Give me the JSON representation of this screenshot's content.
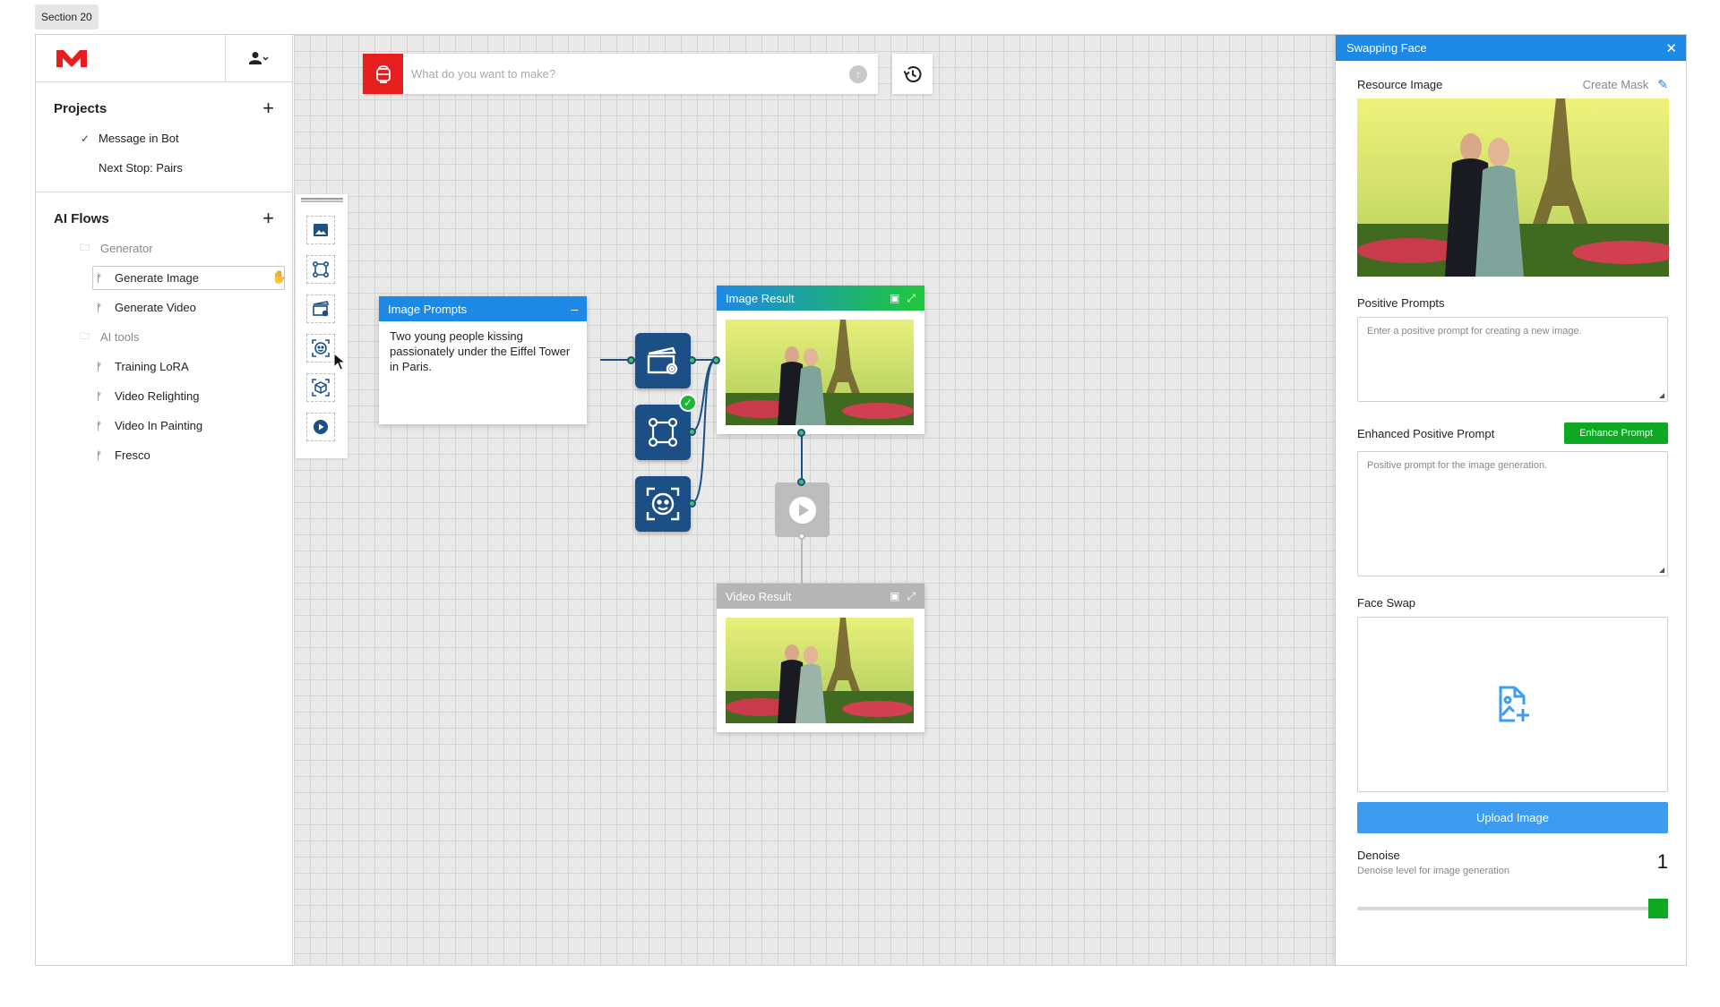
{
  "section_tag": "Section 20",
  "colors": {
    "brand_red": "#e61e1e",
    "accent_blue": "#1e88e5",
    "node_blue": "#1b4f86",
    "success_green": "#0fa823"
  },
  "sidebar": {
    "projects": {
      "title": "Projects",
      "items": [
        {
          "label": "Message in Bot",
          "checked": true
        },
        {
          "label": "Next Stop: Pairs",
          "checked": false
        }
      ]
    },
    "ai_flows": {
      "title": "AI Flows",
      "groups": [
        {
          "name": "Generator",
          "items": [
            "Generate Image",
            "Generate Video"
          ]
        },
        {
          "name": "AI tools",
          "items": [
            "Training LoRA",
            "Video Relighting",
            "Video In Painting",
            "Fresco"
          ]
        }
      ],
      "selected": "Generate Image"
    }
  },
  "canvas": {
    "prompt_placeholder": "What do you want to make?",
    "toolbox_icons": [
      "image-tool-icon",
      "flow-tool-icon",
      "video-settings-tool-icon",
      "face-tool-icon",
      "cube-face-tool-icon",
      "play-tool-icon"
    ],
    "nodes": {
      "image_prompts": {
        "title": "Image Prompts",
        "text": "Two young people kissing passionately under the Eiffel Tower in Paris."
      },
      "image_result": {
        "title": "Image Result"
      },
      "video_result": {
        "title": "Video Result"
      }
    }
  },
  "panel": {
    "title": "Swapping Face",
    "resource_image_label": "Resource Image",
    "create_mask_label": "Create Mask",
    "positive_prompts_label": "Positive Prompts",
    "positive_prompts_placeholder": "Enter a positive prompt for creating a new image.",
    "enhanced_label": "Enhanced Positive Prompt",
    "enhance_button": "Enhance Prompt",
    "enhanced_placeholder": "Positive prompt for the image generation.",
    "face_swap_label": "Face Swap",
    "upload_button": "Upload Image",
    "denoise_label": "Denoise",
    "denoise_desc": "Denoise level for image generation",
    "denoise_value": "1",
    "denoise_fraction": 1
  }
}
